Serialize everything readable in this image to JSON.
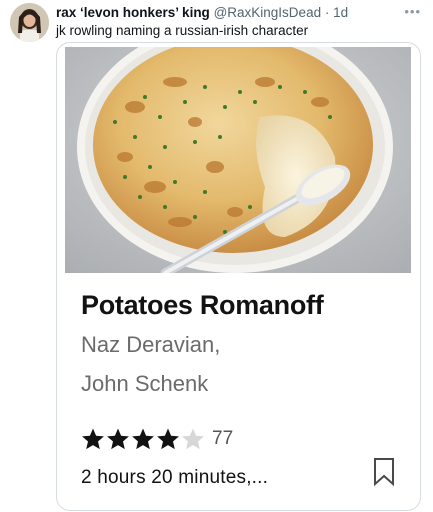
{
  "tweet": {
    "display_name": "rax ‘levon honkers’ king",
    "handle": "@RaxKingIsDead",
    "separator": "·",
    "time": "1d",
    "more_icon": "more-horizontal-icon",
    "text": "jk rowling naming a russian-irish character"
  },
  "card": {
    "title": "Potatoes Romanoff",
    "authors": [
      "Naz Deravian,",
      "John Schenk"
    ],
    "rating": {
      "stars_filled": 4,
      "stars_total": 5,
      "count": "77"
    },
    "duration": "2 hours 20 minutes,...",
    "bookmark_icon": "bookmark-icon",
    "colors": {
      "star_filled": "#121212",
      "star_empty": "#d7d7d7"
    }
  }
}
